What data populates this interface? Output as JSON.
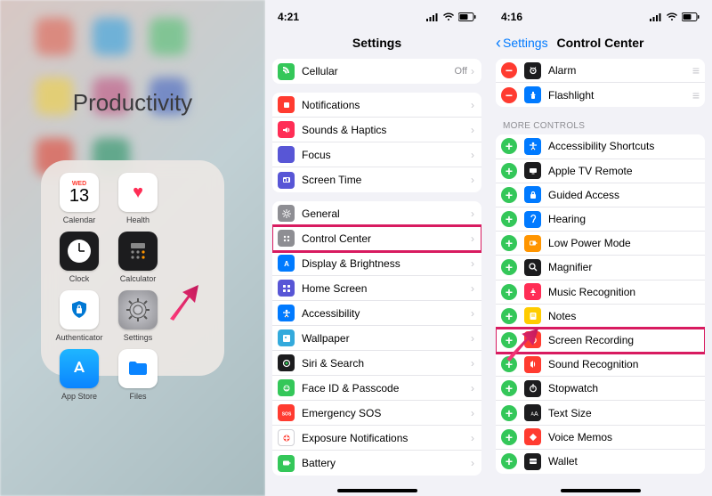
{
  "panel1": {
    "folder_title": "Productivity",
    "calendar": {
      "weekday": "WED",
      "day": "13"
    },
    "apps": [
      {
        "name": "Calendar",
        "label": "Calendar"
      },
      {
        "name": "Health",
        "label": "Health"
      },
      {
        "name": "Clock",
        "label": "Clock"
      },
      {
        "name": "Calculator",
        "label": "Calculator"
      },
      {
        "name": "Authenticator",
        "label": "Authenticator"
      },
      {
        "name": "Settings",
        "label": "Settings"
      },
      {
        "name": "App Store",
        "label": "App Store"
      },
      {
        "name": "Files",
        "label": "Files"
      }
    ]
  },
  "panel2": {
    "time": "4:21",
    "title": "Settings",
    "cellular": {
      "label": "Cellular",
      "detail": "Off"
    },
    "group2": [
      {
        "label": "Notifications",
        "color": "#ff3b30",
        "glyph": "notif"
      },
      {
        "label": "Sounds & Haptics",
        "color": "#ff2d55",
        "glyph": "sound"
      },
      {
        "label": "Focus",
        "color": "#5856d6",
        "glyph": "focus"
      },
      {
        "label": "Screen Time",
        "color": "#5856d6",
        "glyph": "time"
      }
    ],
    "group3": [
      {
        "label": "General",
        "color": "#8e8e93",
        "glyph": "gear"
      },
      {
        "label": "Control Center",
        "color": "#8e8e93",
        "glyph": "cc",
        "highlight": true
      },
      {
        "label": "Display & Brightness",
        "color": "#007aff",
        "glyph": "aa"
      },
      {
        "label": "Home Screen",
        "color": "#5856d6",
        "glyph": "grid"
      },
      {
        "label": "Accessibility",
        "color": "#007aff",
        "glyph": "access"
      },
      {
        "label": "Wallpaper",
        "color": "#34aadc",
        "glyph": "wall"
      },
      {
        "label": "Siri & Search",
        "color": "#1c1c1e",
        "glyph": "siri"
      },
      {
        "label": "Face ID & Passcode",
        "color": "#34c759",
        "glyph": "face"
      },
      {
        "label": "Emergency SOS",
        "color": "#ff3b30",
        "glyph": "sos"
      },
      {
        "label": "Exposure Notifications",
        "color": "#ffffff",
        "glyph": "exp"
      },
      {
        "label": "Battery",
        "color": "#34c759",
        "glyph": "batt"
      }
    ]
  },
  "panel3": {
    "time": "4:16",
    "back": "Settings",
    "title": "Control Center",
    "included_tail": [
      {
        "label": "Alarm",
        "color": "#1c1c1e",
        "glyph": "alarm"
      },
      {
        "label": "Flashlight",
        "color": "#007aff",
        "glyph": "flash"
      }
    ],
    "section_header": "MORE CONTROLS",
    "more": [
      {
        "label": "Accessibility Shortcuts",
        "color": "#007aff",
        "glyph": "access"
      },
      {
        "label": "Apple TV Remote",
        "color": "#1c1c1e",
        "glyph": "tv"
      },
      {
        "label": "Guided Access",
        "color": "#007aff",
        "glyph": "lock"
      },
      {
        "label": "Hearing",
        "color": "#007aff",
        "glyph": "ear"
      },
      {
        "label": "Low Power Mode",
        "color": "#ff9500",
        "glyph": "low"
      },
      {
        "label": "Magnifier",
        "color": "#1c1c1e",
        "glyph": "mag"
      },
      {
        "label": "Music Recognition",
        "color": "#ff2d55",
        "glyph": "music"
      },
      {
        "label": "Notes",
        "color": "#ffcc00",
        "glyph": "note"
      },
      {
        "label": "Screen Recording",
        "color": "#ff3b30",
        "glyph": "rec",
        "highlight": true
      },
      {
        "label": "Sound Recognition",
        "color": "#ff3b30",
        "glyph": "sndr"
      },
      {
        "label": "Stopwatch",
        "color": "#1c1c1e",
        "glyph": "stop"
      },
      {
        "label": "Text Size",
        "color": "#1c1c1e",
        "glyph": "txt"
      },
      {
        "label": "Voice Memos",
        "color": "#ff3b30",
        "glyph": "voice"
      },
      {
        "label": "Wallet",
        "color": "#1c1c1e",
        "glyph": "wallet"
      }
    ]
  }
}
